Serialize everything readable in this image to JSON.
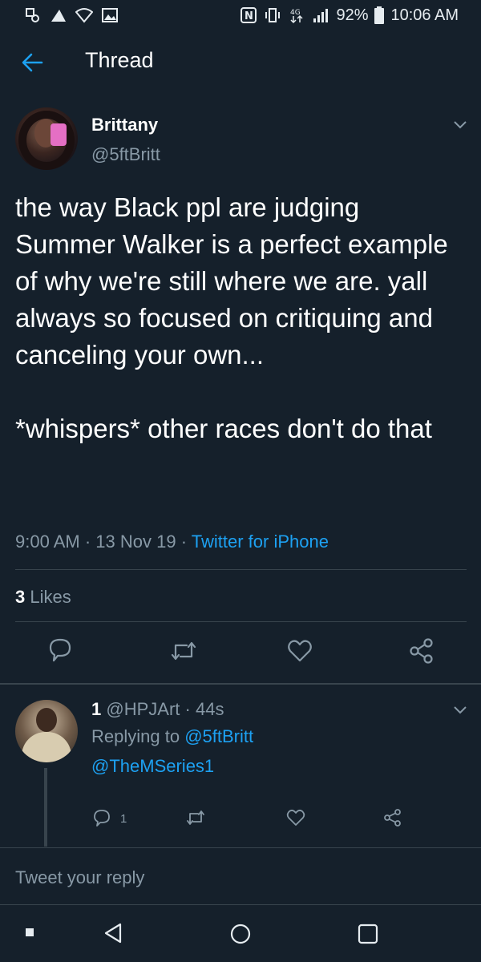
{
  "status_bar": {
    "battery": "92%",
    "time": "10:06 AM",
    "icons": [
      "notification-icon",
      "vpn-icon",
      "wifi-icon",
      "gallery-icon",
      "nfc-icon",
      "vibrate-icon",
      "data-4g-icon",
      "signal-icon",
      "battery-icon"
    ]
  },
  "app_bar": {
    "back_icon": "arrow-left-icon",
    "title": "Thread"
  },
  "tweet": {
    "name": "Brittany",
    "handle": "@5ftBritt",
    "text": "the way Black ppl are judging Summer Walker is a perfect example of why we're still where we are. yall always so focused on critiquing and canceling your own...\n\n*whispers* other races don't do that",
    "time": "9:00 AM",
    "date": "13 Nov 19",
    "dot": "·",
    "source": "Twitter for iPhone",
    "likes_count": "3",
    "likes_label": "Likes"
  },
  "reply": {
    "name": "1",
    "handle": "@HPJArt",
    "age": "44s",
    "dot": "·",
    "replying_to_label": "Replying to",
    "replying_to_handle": "@5ftBritt",
    "text": "@TheMSeries1",
    "reply_count": "1"
  },
  "compose": {
    "placeholder": "Tweet your reply"
  },
  "colors": {
    "background": "#15202b",
    "accent": "#1da1f2",
    "secondary_text": "#8899a6",
    "divider": "#38444d"
  }
}
